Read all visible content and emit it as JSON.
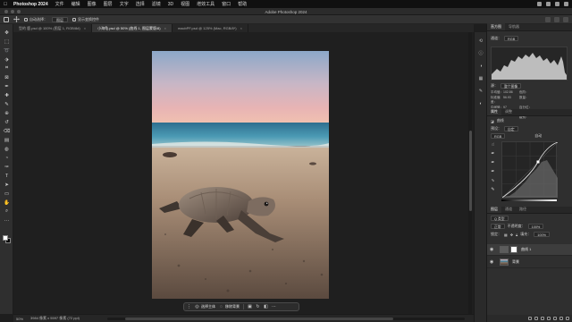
{
  "menubar": {
    "app_name": "Photoshop 2024",
    "items": [
      "文件",
      "编辑",
      "图像",
      "图层",
      "文字",
      "选择",
      "滤镜",
      "3D",
      "视图",
      "增效工具",
      "窗口",
      "帮助"
    ]
  },
  "window": {
    "title": "Adobe Photoshop 2024"
  },
  "options": {
    "auto_select_label": "自动选择：",
    "auto_select_value": "图层",
    "transform_label": "显示变换控件"
  },
  "tabs": [
    {
      "label": "型的 鹿.psd @ 100% (图层 1, RGB/8#)",
      "active": false
    },
    {
      "label": "小海龟.psd @ 50% (曲线 1, 图层蒙版/8)",
      "active": true
    },
    {
      "label": "macbPF.psd @ 125% (Mac, RGB/8*)",
      "active": false
    }
  ],
  "toolbar": {
    "tools": [
      "move-tool-icon",
      "marquee-tool-icon",
      "lasso-tool-icon",
      "object-select-tool-icon",
      "crop-tool-icon",
      "frame-tool-icon",
      "eyedropper-tool-icon",
      "spot-heal-tool-icon",
      "brush-tool-icon",
      "clone-stamp-tool-icon",
      "history-brush-tool-icon",
      "eraser-tool-icon",
      "gradient-tool-icon",
      "blur-tool-icon",
      "dodge-tool-icon",
      "pen-tool-icon",
      "type-tool-icon",
      "path-select-tool-icon",
      "rectangle-tool-icon",
      "hand-tool-icon",
      "zoom-tool-icon",
      "more-tools-icon"
    ],
    "foreground_color": "#ffffff",
    "background_color": "#000000"
  },
  "taskbar": {
    "select_subject": "选择主体",
    "remove_bg": "移除背景"
  },
  "statusbar": {
    "zoom": "50%",
    "doc_info": "3984 像素 x 5597 像素 (72 ppi)"
  },
  "histogram": {
    "tabs": [
      "直方图",
      "导航器"
    ],
    "channel_label": "通道：",
    "channel_value": "RGB",
    "source_label": "源：",
    "source_value": "整个图像",
    "stats": [
      {
        "label": "平均值：",
        "value": "102.86"
      },
      {
        "label": "色阶：",
        "value": ""
      },
      {
        "label": "标准偏差：",
        "value": "56.93"
      },
      {
        "label": "数量：",
        "value": ""
      },
      {
        "label": "中间值：",
        "value": "97"
      },
      {
        "label": "百分位：",
        "value": ""
      },
      {
        "label": "像素：",
        "value": "7231488"
      },
      {
        "label": "高速缓存级别：",
        "value": "4"
      }
    ]
  },
  "properties": {
    "tabs": [
      "属性",
      "调整"
    ],
    "layer_type": "曲线",
    "preset_label": "预设：",
    "preset_value": "自定",
    "channel_value": "RGB",
    "auto_label": "自动"
  },
  "layers": {
    "tabs": [
      "图层",
      "通道",
      "路径"
    ],
    "kind_label": "Q 类型",
    "blend_mode": "正常",
    "opacity_label": "不透明度：",
    "opacity_value": "100%",
    "lock_label": "锁定：",
    "fill_label": "填充：",
    "fill_value": "100%",
    "items": [
      {
        "name": "曲线 1",
        "selected": true
      },
      {
        "name": "背景",
        "selected": false
      }
    ]
  },
  "colors": {
    "accent": "#4a90e2",
    "panel": "#2f2f2f",
    "canvas": "#1f1f1f"
  }
}
